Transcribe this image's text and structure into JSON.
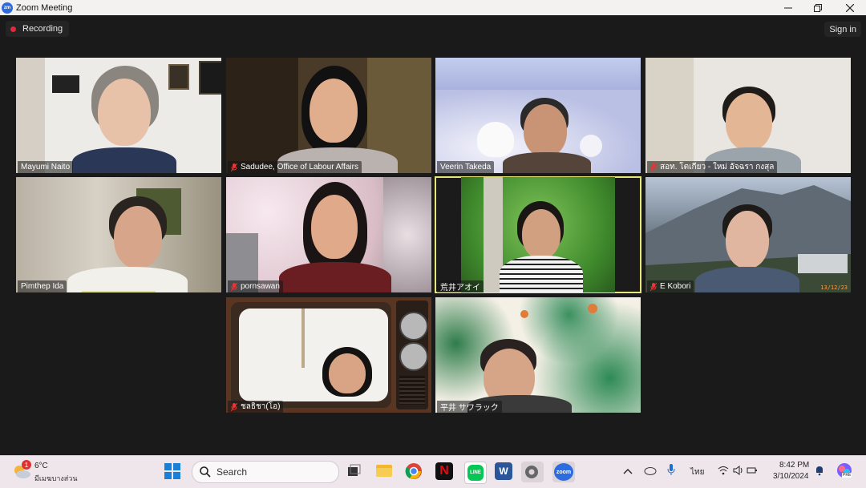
{
  "window": {
    "title": "Zoom Meeting",
    "logo_text": "zm"
  },
  "meeting": {
    "recording_label": "Recording",
    "sign_in_label": "Sign in"
  },
  "participants": [
    {
      "name": "Mayumi Naito",
      "muted": false
    },
    {
      "name": "Sadudee, Office of Labour Affairs",
      "muted": true
    },
    {
      "name": "Veerin Takeda",
      "muted": false
    },
    {
      "name": "สอท. โตเกียว - ใหม่ อัจฉรา กงสุล",
      "muted": true
    },
    {
      "name": "Pimthep Ida",
      "muted": false
    },
    {
      "name": "pornsawan",
      "muted": true
    },
    {
      "name": "荒井アオイ",
      "muted": false,
      "active_speaker": true
    },
    {
      "name": "E Kobori",
      "muted": true
    },
    {
      "name": "ชลธิชา(โอ)",
      "muted": true
    },
    {
      "name": "平井 サワラック",
      "muted": false
    }
  ],
  "tile_overlays": {
    "kobori_date": "13/12/23"
  },
  "taskbar": {
    "weather_temp": "6°C",
    "weather_desc": "มีเมฆบางส่วน",
    "weather_badge": "1",
    "search_placeholder": "Search",
    "language": "ไทย",
    "time": "8:42 PM",
    "date": "3/10/2024",
    "zoom_label": "zoom",
    "line_label": "LINE",
    "word_label": "W",
    "netflix_label": "N",
    "copilot_label": "PRE"
  },
  "colors": {
    "recording_dot": "#e0293b",
    "active_border": "#e6e57a",
    "zoom_blue": "#2d6cdf"
  }
}
